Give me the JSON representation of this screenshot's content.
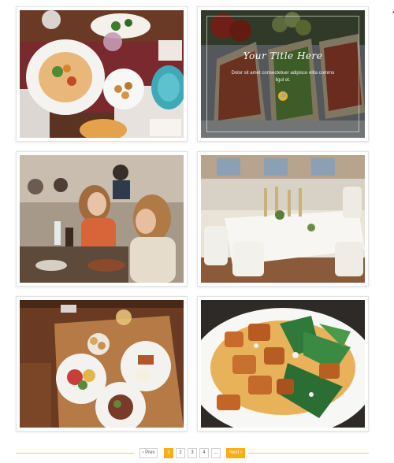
{
  "gallery": {
    "items": [
      {
        "name": "restaurant-table-food-photo"
      },
      {
        "name": "sandwich-photo",
        "overlay": {
          "title": "Your Title Here",
          "text": "Dolor sit amet consectetuer adipisce elita commo ligul et.",
          "link_icon": "link-icon"
        }
      },
      {
        "name": "friends-dining-photo"
      },
      {
        "name": "banquet-hall-photo"
      },
      {
        "name": "wooden-table-dishes-photo"
      },
      {
        "name": "chicken-salad-photo"
      }
    ]
  },
  "pagination": {
    "prev_label": "‹ Prev",
    "pages": [
      "1",
      "2",
      "3",
      "4",
      "..."
    ],
    "active_page": "1",
    "next_label": "Next ›"
  },
  "colors": {
    "accent": "#f5b014",
    "line": "#f1c97a"
  }
}
